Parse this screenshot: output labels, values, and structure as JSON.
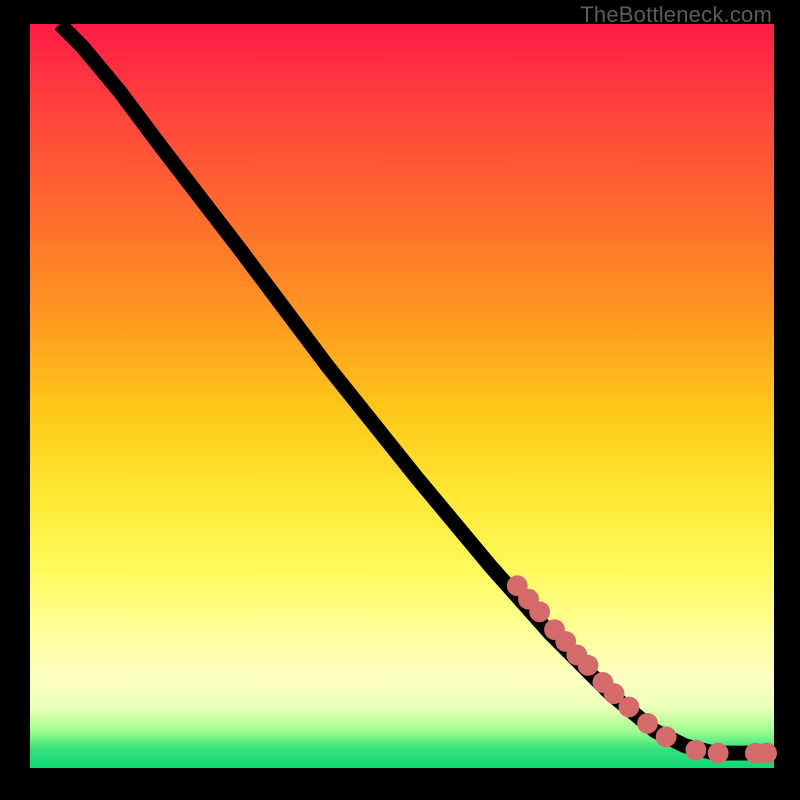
{
  "watermark": "TheBottleneck.com",
  "colors": {
    "dot": "#d46a6a",
    "curve": "#000000",
    "page_bg": "#000000"
  },
  "chart_data": {
    "type": "line",
    "note": "Values estimated in normalized 0–100 coordinates (x: left→right, y: bottom→top) from the rendered figure. The curve starts near top-left, descends roughly linearly, and flattens near the bottom-right. Dots cluster on the lower-right portion of the curve.",
    "xlim": [
      0,
      100
    ],
    "ylim": [
      0,
      100
    ],
    "title": "",
    "xlabel": "",
    "ylabel": "",
    "curve_points": [
      {
        "x": 4,
        "y": 100
      },
      {
        "x": 7,
        "y": 97
      },
      {
        "x": 12,
        "y": 91
      },
      {
        "x": 18,
        "y": 83
      },
      {
        "x": 28,
        "y": 70
      },
      {
        "x": 40,
        "y": 54
      },
      {
        "x": 52,
        "y": 39
      },
      {
        "x": 62,
        "y": 27
      },
      {
        "x": 70,
        "y": 18
      },
      {
        "x": 78,
        "y": 10
      },
      {
        "x": 84,
        "y": 5
      },
      {
        "x": 88,
        "y": 3
      },
      {
        "x": 92,
        "y": 2
      },
      {
        "x": 96,
        "y": 2
      },
      {
        "x": 99,
        "y": 2
      }
    ],
    "dots": [
      {
        "x": 65.5,
        "y": 24.5,
        "r": 1.4
      },
      {
        "x": 67.0,
        "y": 22.7,
        "r": 1.4
      },
      {
        "x": 68.5,
        "y": 21.0,
        "r": 1.4
      },
      {
        "x": 70.5,
        "y": 18.6,
        "r": 1.4
      },
      {
        "x": 72.0,
        "y": 17.0,
        "r": 1.4
      },
      {
        "x": 73.5,
        "y": 15.2,
        "r": 1.4
      },
      {
        "x": 75.0,
        "y": 13.8,
        "r": 1.4
      },
      {
        "x": 77.0,
        "y": 11.5,
        "r": 1.4
      },
      {
        "x": 78.5,
        "y": 10.0,
        "r": 1.4
      },
      {
        "x": 80.5,
        "y": 8.2,
        "r": 1.4
      },
      {
        "x": 83.0,
        "y": 6.0,
        "r": 1.4
      },
      {
        "x": 85.5,
        "y": 4.2,
        "r": 1.4
      },
      {
        "x": 89.5,
        "y": 2.4,
        "r": 1.4
      },
      {
        "x": 92.5,
        "y": 2.0,
        "r": 1.4
      },
      {
        "x": 97.5,
        "y": 2.0,
        "r": 1.4
      },
      {
        "x": 99.0,
        "y": 2.0,
        "r": 1.4
      }
    ]
  }
}
